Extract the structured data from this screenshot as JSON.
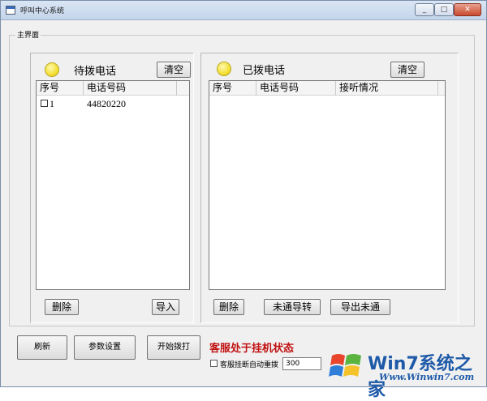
{
  "window": {
    "title": "呼叫中心系统",
    "min": "_",
    "max": "□",
    "close": "✕"
  },
  "frame": {
    "label": "主界面"
  },
  "pending": {
    "heading": "待拨电话",
    "clear_label": "清空",
    "columns": [
      "序号",
      "电话号码"
    ],
    "rows": [
      {
        "index": "1",
        "phone": "44820220"
      }
    ],
    "delete_label": "删除",
    "import_label": "导入"
  },
  "dialed": {
    "heading": "已拨电话",
    "clear_label": "清空",
    "columns": [
      "序号",
      "电话号码",
      "接听情况"
    ],
    "rows": [],
    "delete_label": "删除",
    "forward_label": "未通导转",
    "export_label": "导出未通"
  },
  "toolbar": {
    "refresh_label": "刷新",
    "settings_label": "参数设置",
    "start_label": "开始拨打"
  },
  "status": {
    "text": "客服处于挂机状态"
  },
  "auto_redial": {
    "label": "客服挂断自动重拨",
    "value": "300"
  },
  "watermark": {
    "brand": "Win7系统之家",
    "url": "Www.Winwin7.com"
  }
}
